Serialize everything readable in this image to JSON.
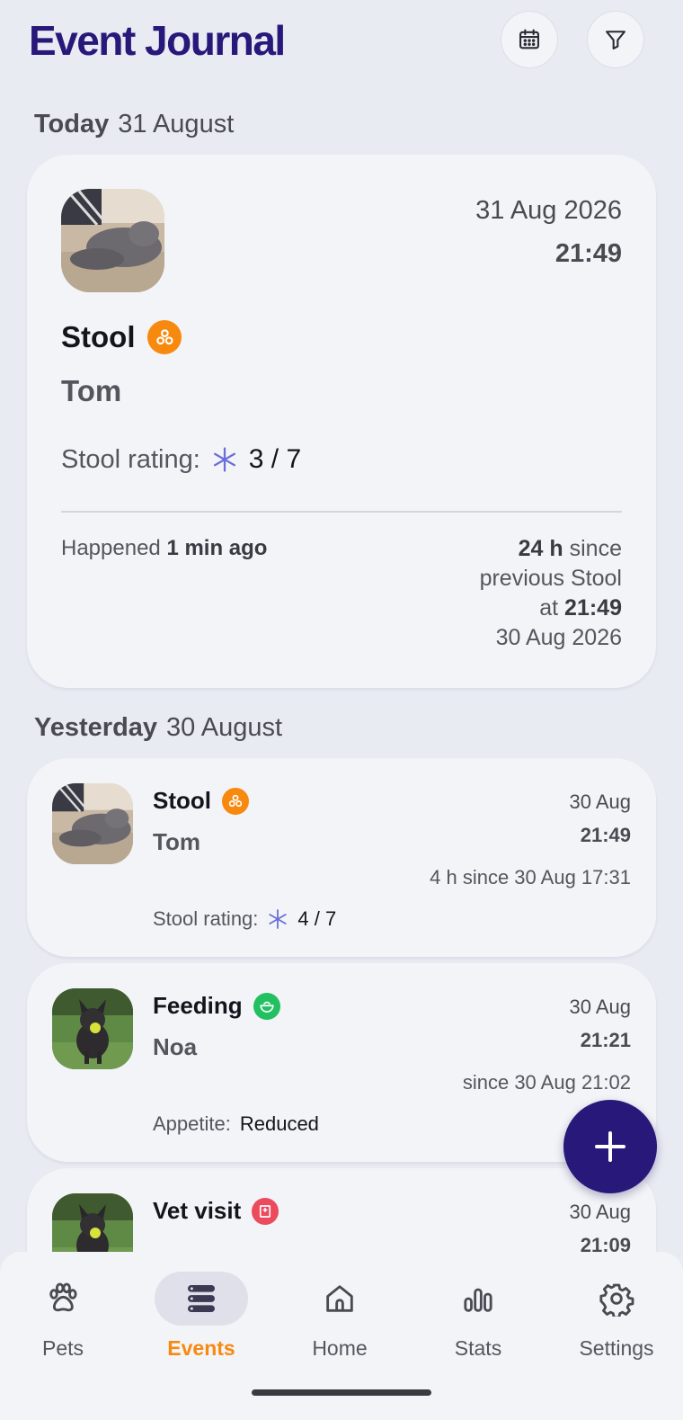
{
  "app": {
    "title": "Event Journal"
  },
  "header": {
    "calendar_icon": "calendar-icon",
    "filter_icon": "filter-icon"
  },
  "sections": [
    {
      "label": "Today",
      "date": "31 August"
    },
    {
      "label": "Yesterday",
      "date": "30 August"
    }
  ],
  "featured": {
    "date": "31 Aug 2026",
    "time": "21:49",
    "type": "Stool",
    "pet": "Tom",
    "rating_label": "Stool rating:",
    "rating_value": "3 / 7",
    "happened_label": "Happened",
    "happened_value": "1 min ago",
    "since_duration": "24 h",
    "since_word": "since",
    "since_previous": "previous Stool",
    "since_at": "at",
    "since_time": "21:49",
    "since_date": "30 Aug 2026"
  },
  "events": [
    {
      "type": "Stool",
      "pet": "Tom",
      "date": "30 Aug",
      "time": "21:49",
      "since": "4 h since 30 Aug 17:31",
      "detail_label": "Stool rating:",
      "detail_value": "4 / 7",
      "badge_color": "#f7890f",
      "icon": "stool-icon"
    },
    {
      "type": "Feeding",
      "pet": "Noa",
      "date": "30 Aug",
      "time": "21:21",
      "since": "since 30 Aug 21:02",
      "detail_label": "Appetite:",
      "detail_value": "Reduced",
      "badge_color": "#22c061",
      "icon": "bowl-icon"
    },
    {
      "type": "Vet visit",
      "date": "30 Aug",
      "time": "21:09",
      "badge_color": "#ec4a5d",
      "icon": "hospital-icon"
    }
  ],
  "fab": {
    "icon": "plus-icon"
  },
  "nav": [
    {
      "label": "Pets",
      "icon": "paw-icon"
    },
    {
      "label": "Events",
      "icon": "list-icon",
      "active": true
    },
    {
      "label": "Home",
      "icon": "home-icon"
    },
    {
      "label": "Stats",
      "icon": "bar-chart-icon"
    },
    {
      "label": "Settings",
      "icon": "gear-icon"
    }
  ],
  "colors": {
    "brand": "#27187a",
    "accent": "#f7890f",
    "background": "#e9ebf3",
    "card": "#f3f4f8"
  }
}
